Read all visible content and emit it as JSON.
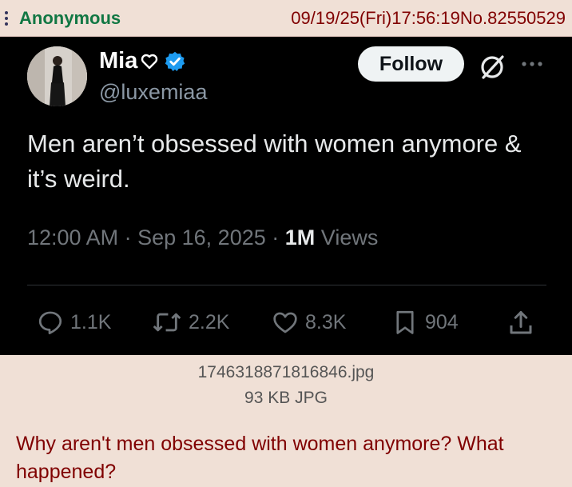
{
  "post": {
    "name": "Anonymous",
    "datetime": "09/19/25(Fri)17:56:19",
    "number": "No.82550529",
    "comment": "Why aren't men obsessed with women anymore? What happened?"
  },
  "file": {
    "filename": "1746318871816846.jpg",
    "meta": "93 KB JPG"
  },
  "tweet": {
    "display_name": "Mia",
    "handle": "@luxemiaa",
    "follow_label": "Follow",
    "text": "Men aren’t obsessed with women anymore & it’s weird.",
    "time": "12:00 AM",
    "date": "Sep 16, 2025",
    "views_count": "1M",
    "views_label": "Views",
    "replies": "1.1K",
    "reposts": "2.2K",
    "likes": "8.3K",
    "bookmarks": "904"
  },
  "colors": {
    "page_bg": "#f0e0d6",
    "name_green": "#117743",
    "maroon": "#800000",
    "tweet_bg": "#000000",
    "verified_blue": "#1d9bf0",
    "muted_gray": "#71767b"
  },
  "icons": [
    "menu-icon",
    "heart-icon",
    "verified-icon",
    "grok-icon",
    "more-icon",
    "reply-icon",
    "repost-icon",
    "like-icon",
    "bookmark-icon",
    "share-icon"
  ]
}
